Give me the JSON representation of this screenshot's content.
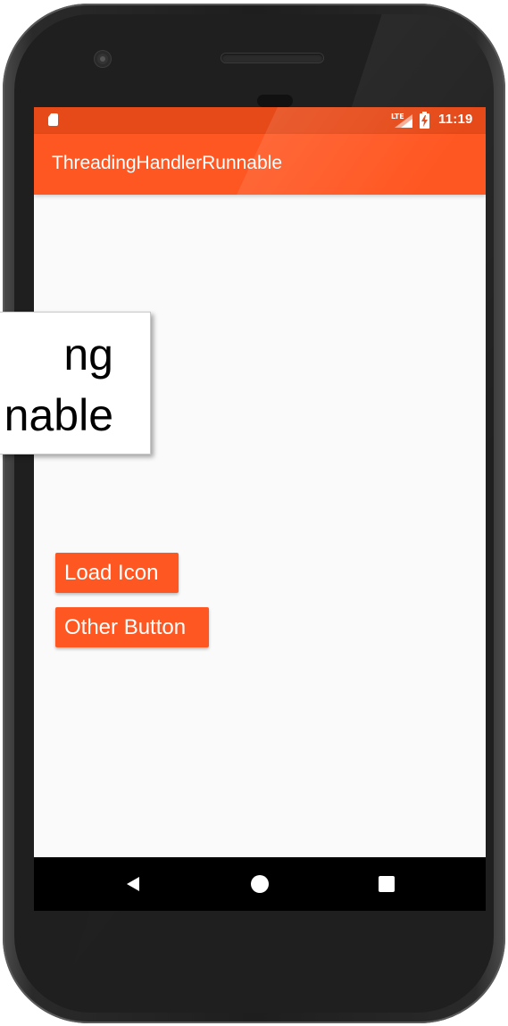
{
  "status_bar": {
    "network_type": "LTE",
    "time": "11:19",
    "icons": [
      "sd-card-icon",
      "signal-icon",
      "battery-charging-icon"
    ]
  },
  "app_bar": {
    "title": "ThreadingHandlerRunnable"
  },
  "buttons": {
    "load_icon": "Load Icon",
    "other_button": "Other Button"
  },
  "nav_bar": {
    "icons": [
      "back-icon",
      "home-icon",
      "recents-icon"
    ]
  },
  "callout": {
    "line1": "ng",
    "line2": "nable"
  },
  "colors": {
    "primary": "#ff5722",
    "primary_dark": "#e64a19",
    "background": "#fafafa",
    "nav_bar": "#000000"
  }
}
